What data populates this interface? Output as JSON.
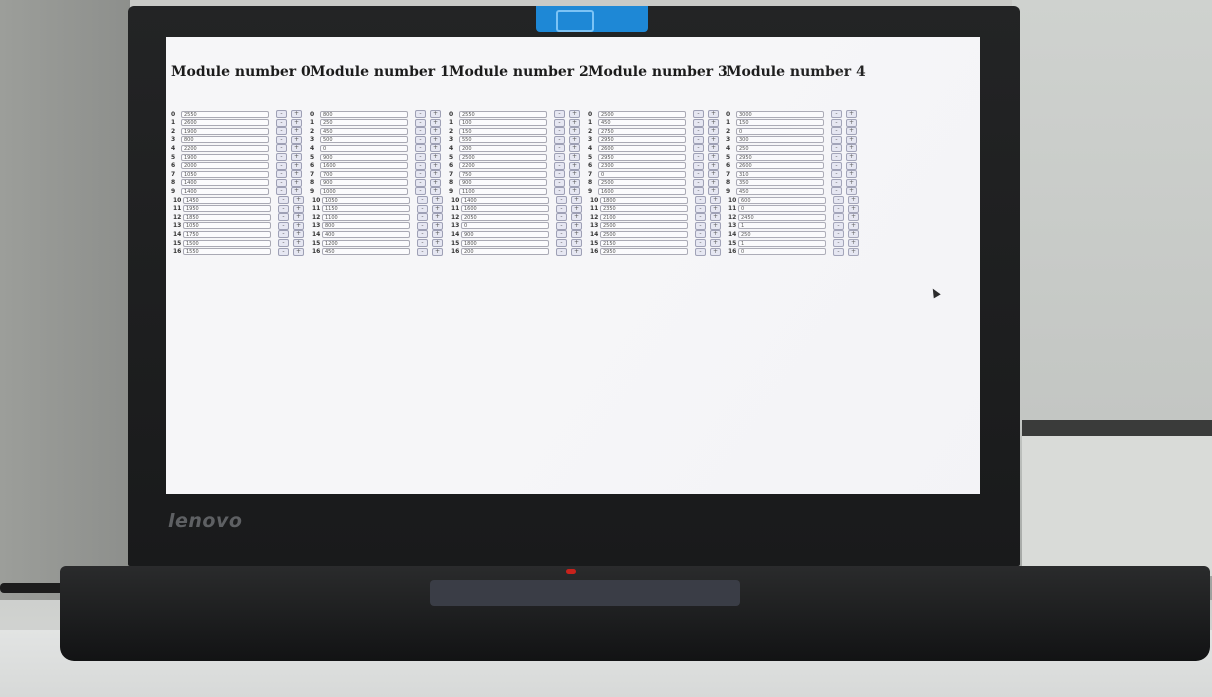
{
  "brand": "lenovo",
  "modules": [
    {
      "title": "Module number 0",
      "rows": [
        {
          "index": "0",
          "value": "2550"
        },
        {
          "index": "1",
          "value": "2600"
        },
        {
          "index": "2",
          "value": "1900"
        },
        {
          "index": "3",
          "value": "800"
        },
        {
          "index": "4",
          "value": "2200"
        },
        {
          "index": "5",
          "value": "1900"
        },
        {
          "index": "6",
          "value": "2000"
        },
        {
          "index": "7",
          "value": "1050"
        },
        {
          "index": "8",
          "value": "1400"
        },
        {
          "index": "9",
          "value": "1400"
        },
        {
          "index": "10",
          "value": "1450"
        },
        {
          "index": "11",
          "value": "1950"
        },
        {
          "index": "12",
          "value": "1850"
        },
        {
          "index": "13",
          "value": "1050"
        },
        {
          "index": "14",
          "value": "1750"
        },
        {
          "index": "15",
          "value": "1500"
        },
        {
          "index": "16",
          "value": "1550"
        }
      ]
    },
    {
      "title": "Module number 1",
      "rows": [
        {
          "index": "0",
          "value": "800"
        },
        {
          "index": "1",
          "value": "250"
        },
        {
          "index": "2",
          "value": "450"
        },
        {
          "index": "3",
          "value": "500"
        },
        {
          "index": "4",
          "value": "0"
        },
        {
          "index": "5",
          "value": "900"
        },
        {
          "index": "6",
          "value": "1600"
        },
        {
          "index": "7",
          "value": "700"
        },
        {
          "index": "8",
          "value": "900"
        },
        {
          "index": "9",
          "value": "1000"
        },
        {
          "index": "10",
          "value": "1050"
        },
        {
          "index": "11",
          "value": "1150"
        },
        {
          "index": "12",
          "value": "1100"
        },
        {
          "index": "13",
          "value": "800"
        },
        {
          "index": "14",
          "value": "400"
        },
        {
          "index": "15",
          "value": "1200"
        },
        {
          "index": "16",
          "value": "450"
        }
      ]
    },
    {
      "title": "Module number 2",
      "rows": [
        {
          "index": "0",
          "value": "2550"
        },
        {
          "index": "1",
          "value": "100"
        },
        {
          "index": "2",
          "value": "150"
        },
        {
          "index": "3",
          "value": "550"
        },
        {
          "index": "4",
          "value": "200"
        },
        {
          "index": "5",
          "value": "2500"
        },
        {
          "index": "6",
          "value": "2200"
        },
        {
          "index": "7",
          "value": "750"
        },
        {
          "index": "8",
          "value": "900"
        },
        {
          "index": "9",
          "value": "1100"
        },
        {
          "index": "10",
          "value": "1400"
        },
        {
          "index": "11",
          "value": "1600"
        },
        {
          "index": "12",
          "value": "2050"
        },
        {
          "index": "13",
          "value": "0"
        },
        {
          "index": "14",
          "value": "900"
        },
        {
          "index": "15",
          "value": "1800"
        },
        {
          "index": "16",
          "value": "200"
        }
      ]
    },
    {
      "title": "Module number 3",
      "rows": [
        {
          "index": "0",
          "value": "2500"
        },
        {
          "index": "1",
          "value": "450"
        },
        {
          "index": "2",
          "value": "2750"
        },
        {
          "index": "3",
          "value": "2950"
        },
        {
          "index": "4",
          "value": "2600"
        },
        {
          "index": "5",
          "value": "2950"
        },
        {
          "index": "6",
          "value": "2300"
        },
        {
          "index": "7",
          "value": "0"
        },
        {
          "index": "8",
          "value": "2500"
        },
        {
          "index": "9",
          "value": "1600"
        },
        {
          "index": "10",
          "value": "1800"
        },
        {
          "index": "11",
          "value": "2350"
        },
        {
          "index": "12",
          "value": "2100"
        },
        {
          "index": "13",
          "value": "2500"
        },
        {
          "index": "14",
          "value": "2500"
        },
        {
          "index": "15",
          "value": "2150"
        },
        {
          "index": "16",
          "value": "2950"
        }
      ]
    },
    {
      "title": "Module number 4",
      "rows": [
        {
          "index": "0",
          "value": "3000"
        },
        {
          "index": "1",
          "value": "150"
        },
        {
          "index": "2",
          "value": "0"
        },
        {
          "index": "3",
          "value": "300"
        },
        {
          "index": "4",
          "value": "250"
        },
        {
          "index": "5",
          "value": "2950"
        },
        {
          "index": "6",
          "value": "2600"
        },
        {
          "index": "7",
          "value": "310"
        },
        {
          "index": "8",
          "value": "350"
        },
        {
          "index": "9",
          "value": "450"
        },
        {
          "index": "10",
          "value": "600"
        },
        {
          "index": "11",
          "value": "0"
        },
        {
          "index": "12",
          "value": "2450"
        },
        {
          "index": "13",
          "value": "1"
        },
        {
          "index": "14",
          "value": "250"
        },
        {
          "index": "15",
          "value": "1"
        },
        {
          "index": "16",
          "value": "0"
        }
      ]
    }
  ],
  "button_labels": {
    "minus": "-",
    "plus": "+"
  }
}
